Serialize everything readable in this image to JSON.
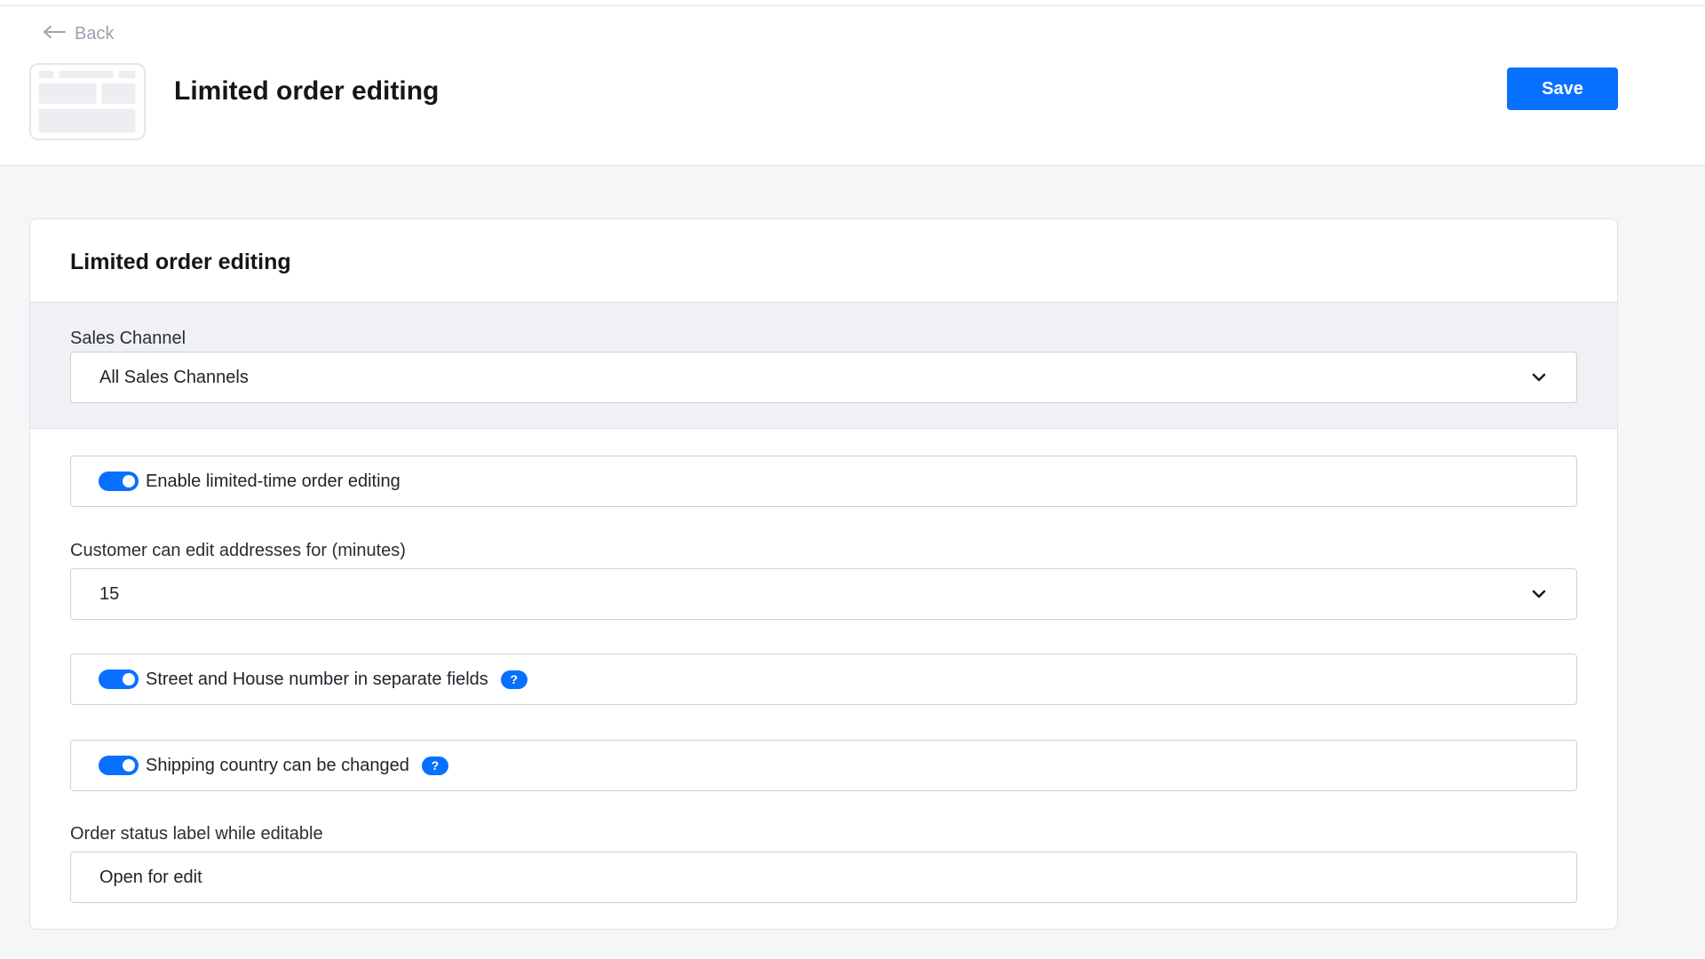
{
  "header": {
    "back_label": "Back",
    "title": "Limited order editing",
    "save_label": "Save",
    "app_icon": "app-thumbnail-icon"
  },
  "card": {
    "title": "Limited order editing",
    "sales_channel": {
      "label": "Sales Channel",
      "value": "All Sales Channels"
    },
    "enable_toggle": {
      "label": "Enable limited-time order editing",
      "on": true
    },
    "minutes": {
      "label": "Customer can edit addresses for (minutes)",
      "value": "15"
    },
    "street_toggle": {
      "label": "Street and House number in separate fields",
      "on": true,
      "help": "?"
    },
    "country_toggle": {
      "label": "Shipping country can be changed",
      "on": true,
      "help": "?"
    },
    "status_label": {
      "label": "Order status label while editable",
      "value": "Open for edit"
    }
  },
  "colors": {
    "accent": "#0870ff",
    "background": "#f5f6f8",
    "band": "#eff1f4"
  }
}
